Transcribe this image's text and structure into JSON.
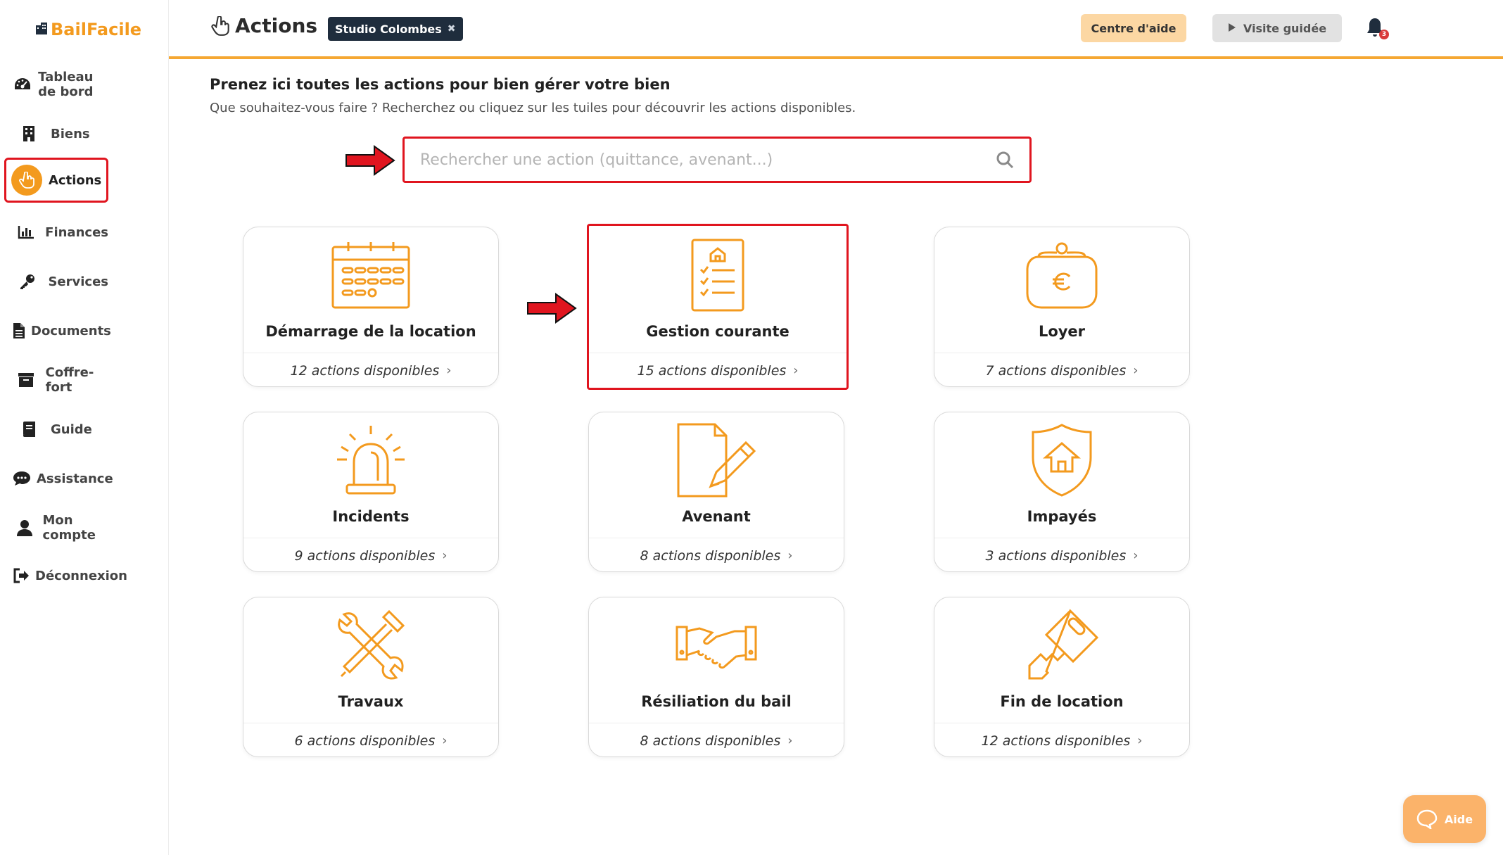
{
  "brand": {
    "name": "BailFacile"
  },
  "sidebar": {
    "items": [
      {
        "label": "Tableau de bord",
        "icon": "dashboard-icon"
      },
      {
        "label": "Biens",
        "icon": "building-icon"
      },
      {
        "label": "Actions",
        "icon": "hand-pointer-icon",
        "active": true
      },
      {
        "label": "Finances",
        "icon": "bar-chart-icon"
      },
      {
        "label": "Services",
        "icon": "key-icon"
      },
      {
        "label": "Documents",
        "icon": "document-icon"
      },
      {
        "label": "Coffre-fort",
        "icon": "archive-icon"
      },
      {
        "label": "Guide",
        "icon": "book-icon"
      },
      {
        "label": "Assistance",
        "icon": "chat-icon"
      },
      {
        "label": "Mon compte",
        "icon": "user-icon"
      },
      {
        "label": "Déconnexion",
        "icon": "logout-icon"
      }
    ]
  },
  "header": {
    "title": "Actions",
    "property_chip": "Studio Colombes",
    "chip_close": "✖",
    "help_center": "Centre d'aide",
    "guided_tour": "Visite guidée",
    "notifications_count": "3"
  },
  "main": {
    "intro_title": "Prenez ici toutes les actions pour bien gérer votre bien",
    "intro_subtitle": "Que souhaitez-vous faire ? Recherchez ou cliquez sur les tuiles pour découvrir les actions disponibles.",
    "search": {
      "placeholder": "Rechercher une action (quittance, avenant...)",
      "value": ""
    },
    "tiles": [
      {
        "title": "Démarrage de la location",
        "count_label": "12 actions disponibles",
        "icon": "calendar-icon"
      },
      {
        "title": "Gestion courante",
        "count_label": "15 actions disponibles",
        "icon": "checklist-icon",
        "highlighted": true
      },
      {
        "title": "Loyer",
        "count_label": "7 actions disponibles",
        "icon": "purse-euro-icon"
      },
      {
        "title": "Incidents",
        "count_label": "9 actions disponibles",
        "icon": "siren-icon"
      },
      {
        "title": "Avenant",
        "count_label": "8 actions disponibles",
        "icon": "document-pen-icon"
      },
      {
        "title": "Impayés",
        "count_label": "3 actions disponibles",
        "icon": "shield-house-icon"
      },
      {
        "title": "Travaux",
        "count_label": "6 actions disponibles",
        "icon": "tools-icon"
      },
      {
        "title": "Résiliation du bail",
        "count_label": "8 actions disponibles",
        "icon": "handshake-icon"
      },
      {
        "title": "Fin de location",
        "count_label": "12 actions disponibles",
        "icon": "key-tag-icon"
      }
    ]
  },
  "aide_button": "Aide",
  "colors": {
    "accent": "#f39a1e",
    "highlight": "#e0151f",
    "dark": "#1f2d3d"
  }
}
